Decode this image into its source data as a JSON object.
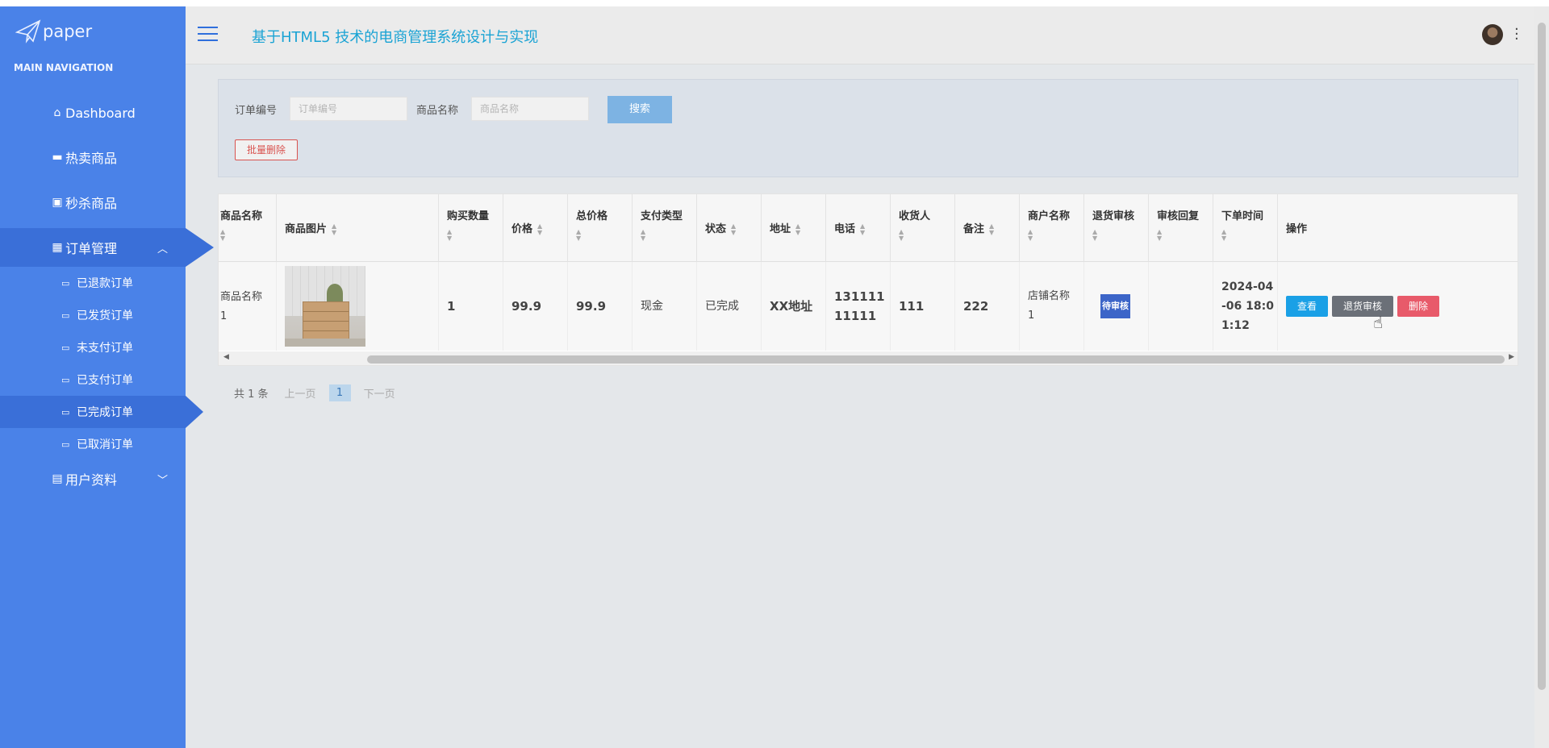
{
  "brand": {
    "name": "paper"
  },
  "nav_heading": "MAIN NAVIGATION",
  "nav": {
    "dashboard": "Dashboard",
    "hot_goods": "热卖商品",
    "flash_sale": "秒杀商品",
    "order_mgmt": "订单管理",
    "user_profile": "用户资料"
  },
  "sub_nav": [
    "已退款订单",
    "已发货订单",
    "未支付订单",
    "已支付订单",
    "已完成订单",
    "已取消订单"
  ],
  "header": {
    "title": "基于HTML5 技术的电商管理系统设计与实现"
  },
  "search": {
    "order_no_label": "订单编号",
    "order_no_placeholder": "订单编号",
    "product_name_label": "商品名称",
    "product_name_placeholder": "商品名称",
    "search_button": "搜索",
    "batch_delete": "批量删除"
  },
  "table": {
    "columns": [
      "商品名称",
      "商品图片",
      "购买数量",
      "价格",
      "总价格",
      "支付类型",
      "状态",
      "地址",
      "电话",
      "收货人",
      "备注",
      "商户名称",
      "退货审核",
      "审核回复",
      "下单时间",
      "操作"
    ],
    "row": {
      "product_name_l1": "商品名称",
      "product_name_l2": "1",
      "qty": "1",
      "price": "99.9",
      "total": "99.9",
      "pay_type": "现金",
      "status": "已完成",
      "address": "XX地址",
      "phone_l1": "131111",
      "phone_l2": "11111",
      "receiver": "111",
      "remark": "222",
      "merchant_l1": "店铺名称",
      "merchant_l2": "1",
      "return_audit": "待审核",
      "audit_reply": "",
      "time_l1": "2024-04",
      "time_l2": "-06 18:0",
      "time_l3": "1:12",
      "actions": {
        "view": "查看",
        "return_audit": "退货审核",
        "delete": "删除"
      }
    }
  },
  "pager": {
    "total": "共 1 条",
    "prev": "上一页",
    "current": "1",
    "next": "下一页"
  },
  "colors": {
    "sidebar": "#4a82e8",
    "accent": "#1aa3d4",
    "search_btn": "#7db3e3",
    "delete": "#e85a6a"
  }
}
